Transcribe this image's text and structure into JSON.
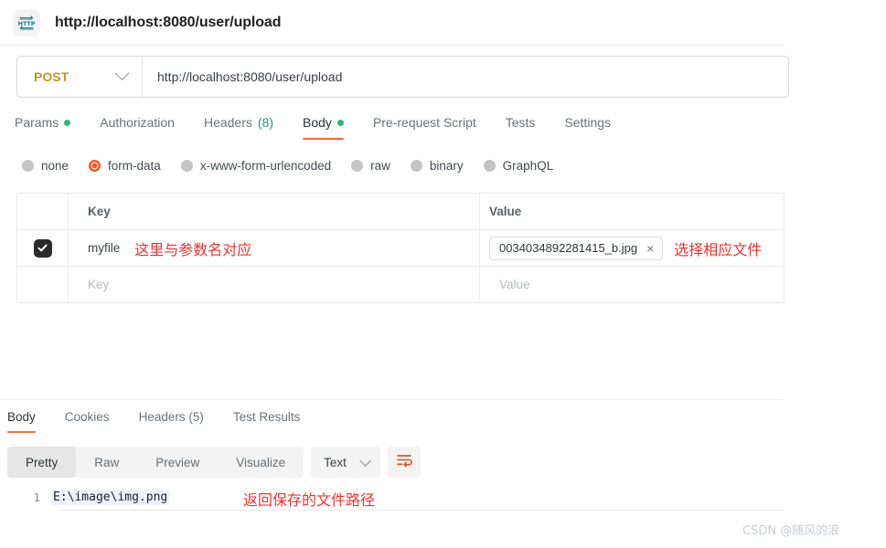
{
  "window": {
    "icon": "http-icon",
    "title": "http://localhost:8080/user/upload"
  },
  "request": {
    "method": "POST",
    "method_caret": "chevron-down-icon",
    "url": "http://localhost:8080/user/upload",
    "tabs": [
      {
        "label": "Params",
        "dot": true,
        "count": "",
        "active": false
      },
      {
        "label": "Authorization",
        "dot": false,
        "count": "",
        "active": false
      },
      {
        "label": "Headers",
        "dot": false,
        "count": "(8)",
        "active": false
      },
      {
        "label": "Body",
        "dot": true,
        "count": "",
        "active": true
      },
      {
        "label": "Pre-request Script",
        "dot": false,
        "count": "",
        "active": false
      },
      {
        "label": "Tests",
        "dot": false,
        "count": "",
        "active": false
      },
      {
        "label": "Settings",
        "dot": false,
        "count": "",
        "active": false
      }
    ],
    "body_types": [
      {
        "label": "none",
        "selected": false
      },
      {
        "label": "form-data",
        "selected": true
      },
      {
        "label": "x-www-form-urlencoded",
        "selected": false
      },
      {
        "label": "raw",
        "selected": false
      },
      {
        "label": "binary",
        "selected": false
      },
      {
        "label": "GraphQL",
        "selected": false
      }
    ],
    "table": {
      "headers": {
        "key": "Key",
        "value": "Value"
      },
      "rows": [
        {
          "checked": true,
          "key": "myfile",
          "key_annotation": "这里与参数名对应",
          "file_name": "0034034892281415_b.jpg",
          "remove_icon": "×",
          "value_annotation": "选择相应文件"
        }
      ],
      "empty_row": {
        "key_placeholder": "Key",
        "value_placeholder": "Value"
      }
    }
  },
  "response": {
    "tabs": [
      {
        "label": "Body",
        "active": true
      },
      {
        "label": "Cookies",
        "active": false
      },
      {
        "label": "Headers (5)",
        "active": false
      },
      {
        "label": "Test Results",
        "active": false
      }
    ],
    "format_buttons": [
      {
        "label": "Pretty",
        "active": true
      },
      {
        "label": "Raw",
        "active": false
      },
      {
        "label": "Preview",
        "active": false
      },
      {
        "label": "Visualize",
        "active": false
      }
    ],
    "type_dropdown": {
      "value": "Text",
      "caret": "chevron-down-icon"
    },
    "wrap_icon": "word-wrap-icon",
    "code": {
      "lines": [
        {
          "number": "1",
          "text": "E:\\image\\img.png"
        }
      ],
      "annotation": "返回保存的文件路径"
    }
  },
  "watermark": "CSDN @随风的浪",
  "colors": {
    "accent": "#f26b3a",
    "method": "#c8912a",
    "annotation": "#f0312e",
    "dot_green": "#2bb673",
    "count_teal": "#2f8f7d"
  }
}
